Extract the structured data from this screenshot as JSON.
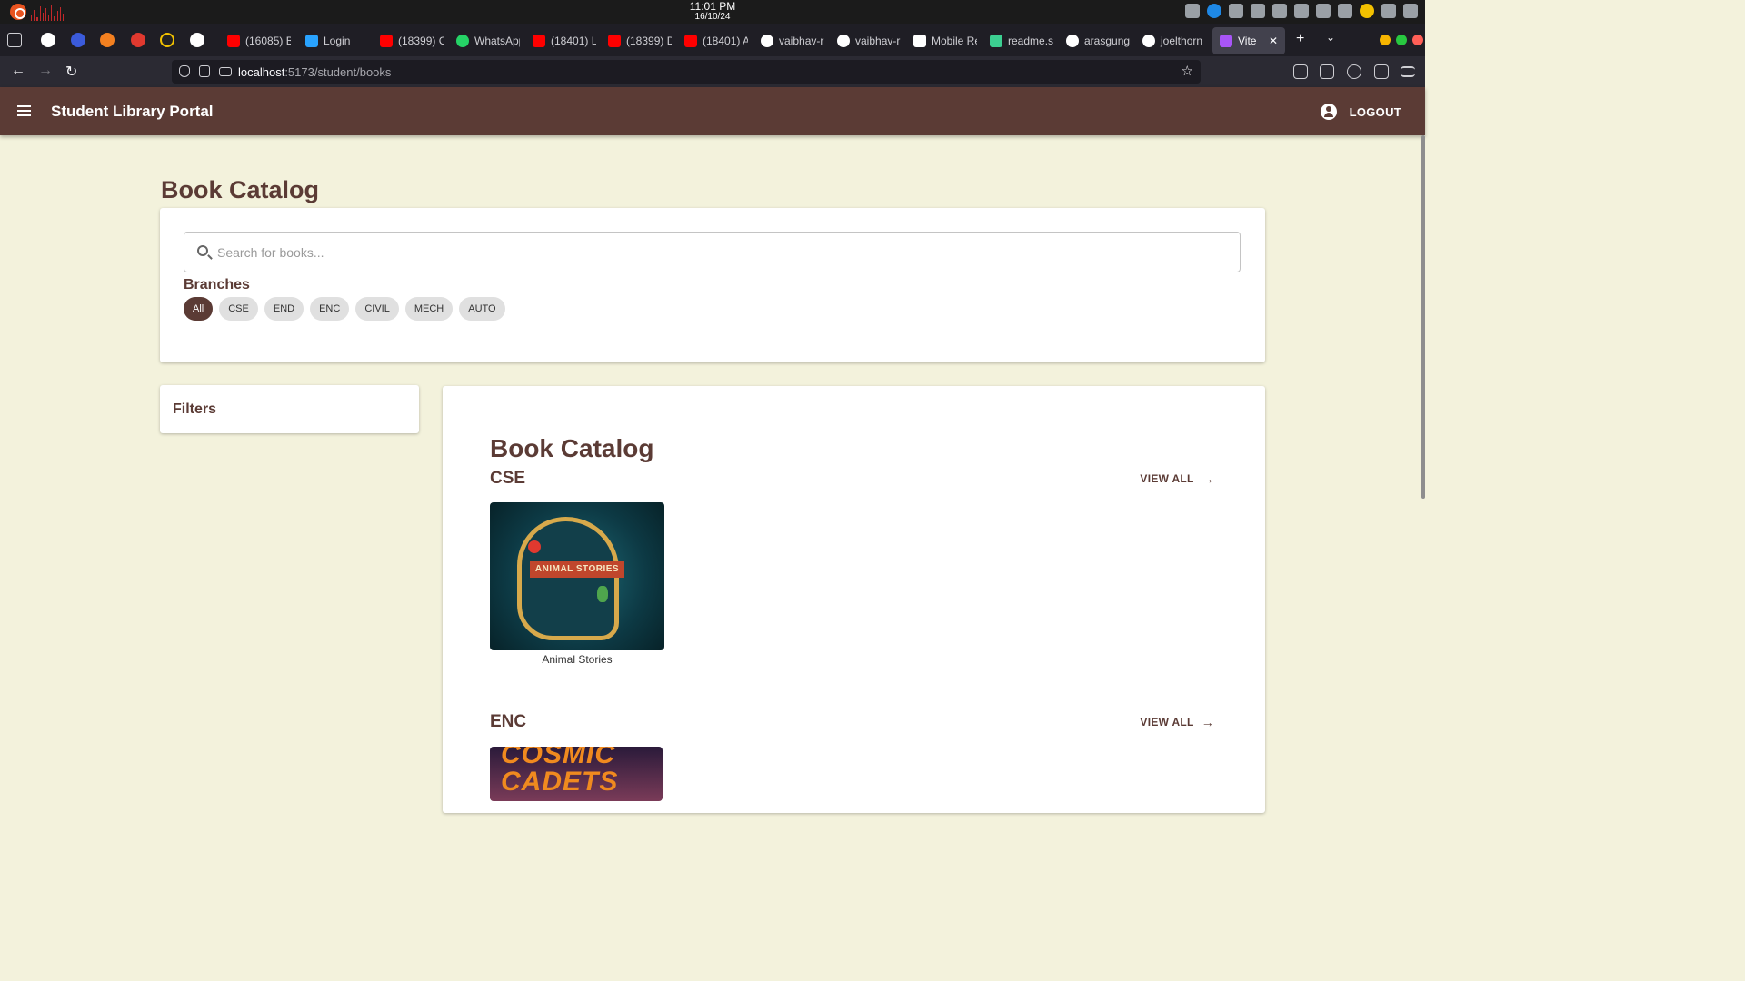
{
  "system": {
    "time": "11:01 PM",
    "date": "16/10/24"
  },
  "browser": {
    "tabs": [
      {
        "label": "(16085) B",
        "color": "#ff0000"
      },
      {
        "label": "Login",
        "color": "#29a3ff"
      },
      {
        "label": "(18399) C",
        "color": "#ff0000"
      },
      {
        "label": "WhatsApp",
        "color": "#25d366"
      },
      {
        "label": "(18401) L",
        "color": "#ff0000"
      },
      {
        "label": "(18399) D",
        "color": "#ff0000"
      },
      {
        "label": "(18401) A",
        "color": "#ff0000"
      },
      {
        "label": "vaibhav-r",
        "color": "#ffffff"
      },
      {
        "label": "vaibhav-r",
        "color": "#ffffff"
      },
      {
        "label": "Mobile Re",
        "color": "#ffffff"
      },
      {
        "label": "readme.s",
        "color": "#3ccf91"
      },
      {
        "label": "arasgung",
        "color": "#ffffff"
      },
      {
        "label": "joelthorn",
        "color": "#ffffff"
      }
    ],
    "active_tab": "Vite + R",
    "url_host": "localhost",
    "url_path": ":5173/student/books"
  },
  "app": {
    "title": "Student Library Portal",
    "logout_label": "LOGOUT",
    "accent": "#5b3b35",
    "background": "#f3f2dc"
  },
  "page": {
    "title": "Book Catalog",
    "search_placeholder": "Search for books...",
    "branches_label": "Branches",
    "branches": [
      "All",
      "CSE",
      "END",
      "ENC",
      "CIVIL",
      "MECH",
      "AUTO"
    ],
    "selected_branch": "All",
    "filters_title": "Filters"
  },
  "catalog": {
    "title": "Book Catalog",
    "view_all_label": "VIEW ALL",
    "sections": [
      {
        "branch": "CSE",
        "books": [
          {
            "title": "Animal Stories",
            "cover_text": "ANIMAL STORIES"
          }
        ]
      },
      {
        "branch": "ENC",
        "books": [
          {
            "title": "",
            "cover_text": "COSMIC CADETS"
          }
        ]
      }
    ]
  }
}
